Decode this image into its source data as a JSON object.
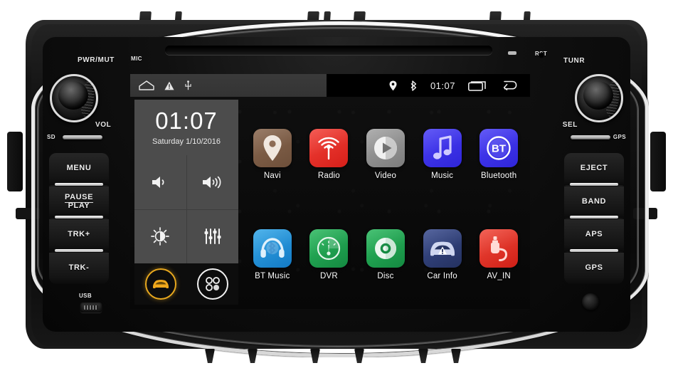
{
  "device": {
    "name": "android-car-head-unit",
    "hardware_labels": {
      "pwr_mut": "PWR/MUT",
      "vol": "VOL",
      "mic": "MIC",
      "sd": "SD",
      "rst": "RST",
      "tunr": "TUNR",
      "sel": "SEL",
      "gps_slot": "GPS",
      "usb": "USB"
    },
    "left_keys": [
      {
        "label": "MENU",
        "name": "menu-button"
      },
      {
        "label_top": "PAUSE",
        "label_bottom": "PLAY",
        "name": "pause-play-button"
      },
      {
        "label": "TRK+",
        "name": "track-next-button"
      },
      {
        "label": "TRK-",
        "name": "track-prev-button"
      }
    ],
    "right_keys": [
      {
        "label": "EJECT",
        "name": "eject-button"
      },
      {
        "label": "BAND",
        "name": "band-button"
      },
      {
        "label": "APS",
        "name": "aps-button"
      },
      {
        "label": "GPS",
        "name": "gps-button"
      }
    ]
  },
  "screen": {
    "statusbar": {
      "left_icons": [
        "home-icon",
        "warning-icon",
        "usb-icon"
      ],
      "right_icons": [
        "location-icon",
        "bluetooth-icon"
      ],
      "time": "01:07",
      "nav_icons": [
        "recents-icon",
        "back-icon"
      ]
    },
    "widget": {
      "clock": "01:07",
      "date": "Saturday 1/10/2016",
      "tiles": [
        {
          "name": "volume-down-tile",
          "icon": "volume-low-icon"
        },
        {
          "name": "volume-up-tile",
          "icon": "volume-high-icon"
        },
        {
          "name": "brightness-tile",
          "icon": "brightness-icon"
        },
        {
          "name": "equalizer-tile",
          "icon": "equalizer-icon"
        }
      ],
      "dock": [
        {
          "name": "car-mode-button",
          "icon": "car-icon",
          "active": true,
          "color": "#e8a81e"
        },
        {
          "name": "all-apps-button",
          "icon": "apps-grid-icon",
          "active": false,
          "color": "#f2f2f2"
        }
      ]
    },
    "apps": [
      {
        "label": "Navi",
        "icon": "map-pin-icon",
        "color": "#7a5a43"
      },
      {
        "label": "Radio",
        "icon": "radio-waves-icon",
        "color": "#e8251f"
      },
      {
        "label": "Video",
        "icon": "play-circle-icon",
        "color": "#8d8d8d"
      },
      {
        "label": "Music",
        "icon": "music-note-icon",
        "color": "#3b35e8"
      },
      {
        "label": "Bluetooth",
        "icon": "bt-badge-icon",
        "color": "#3b35e8"
      },
      {
        "label": "BT Music",
        "icon": "bt-headphones-icon",
        "color": "#1f90d8"
      },
      {
        "label": "DVR",
        "icon": "dashcam-gauge-icon",
        "color": "#1e9e4f"
      },
      {
        "label": "Disc",
        "icon": "disc-icon",
        "color": "#1e9e4f"
      },
      {
        "label": "Car Info",
        "icon": "car-warning-icon",
        "color": "#2e3e78"
      },
      {
        "label": "AV_IN",
        "icon": "rca-plug-icon",
        "color": "#e02b20"
      }
    ]
  }
}
